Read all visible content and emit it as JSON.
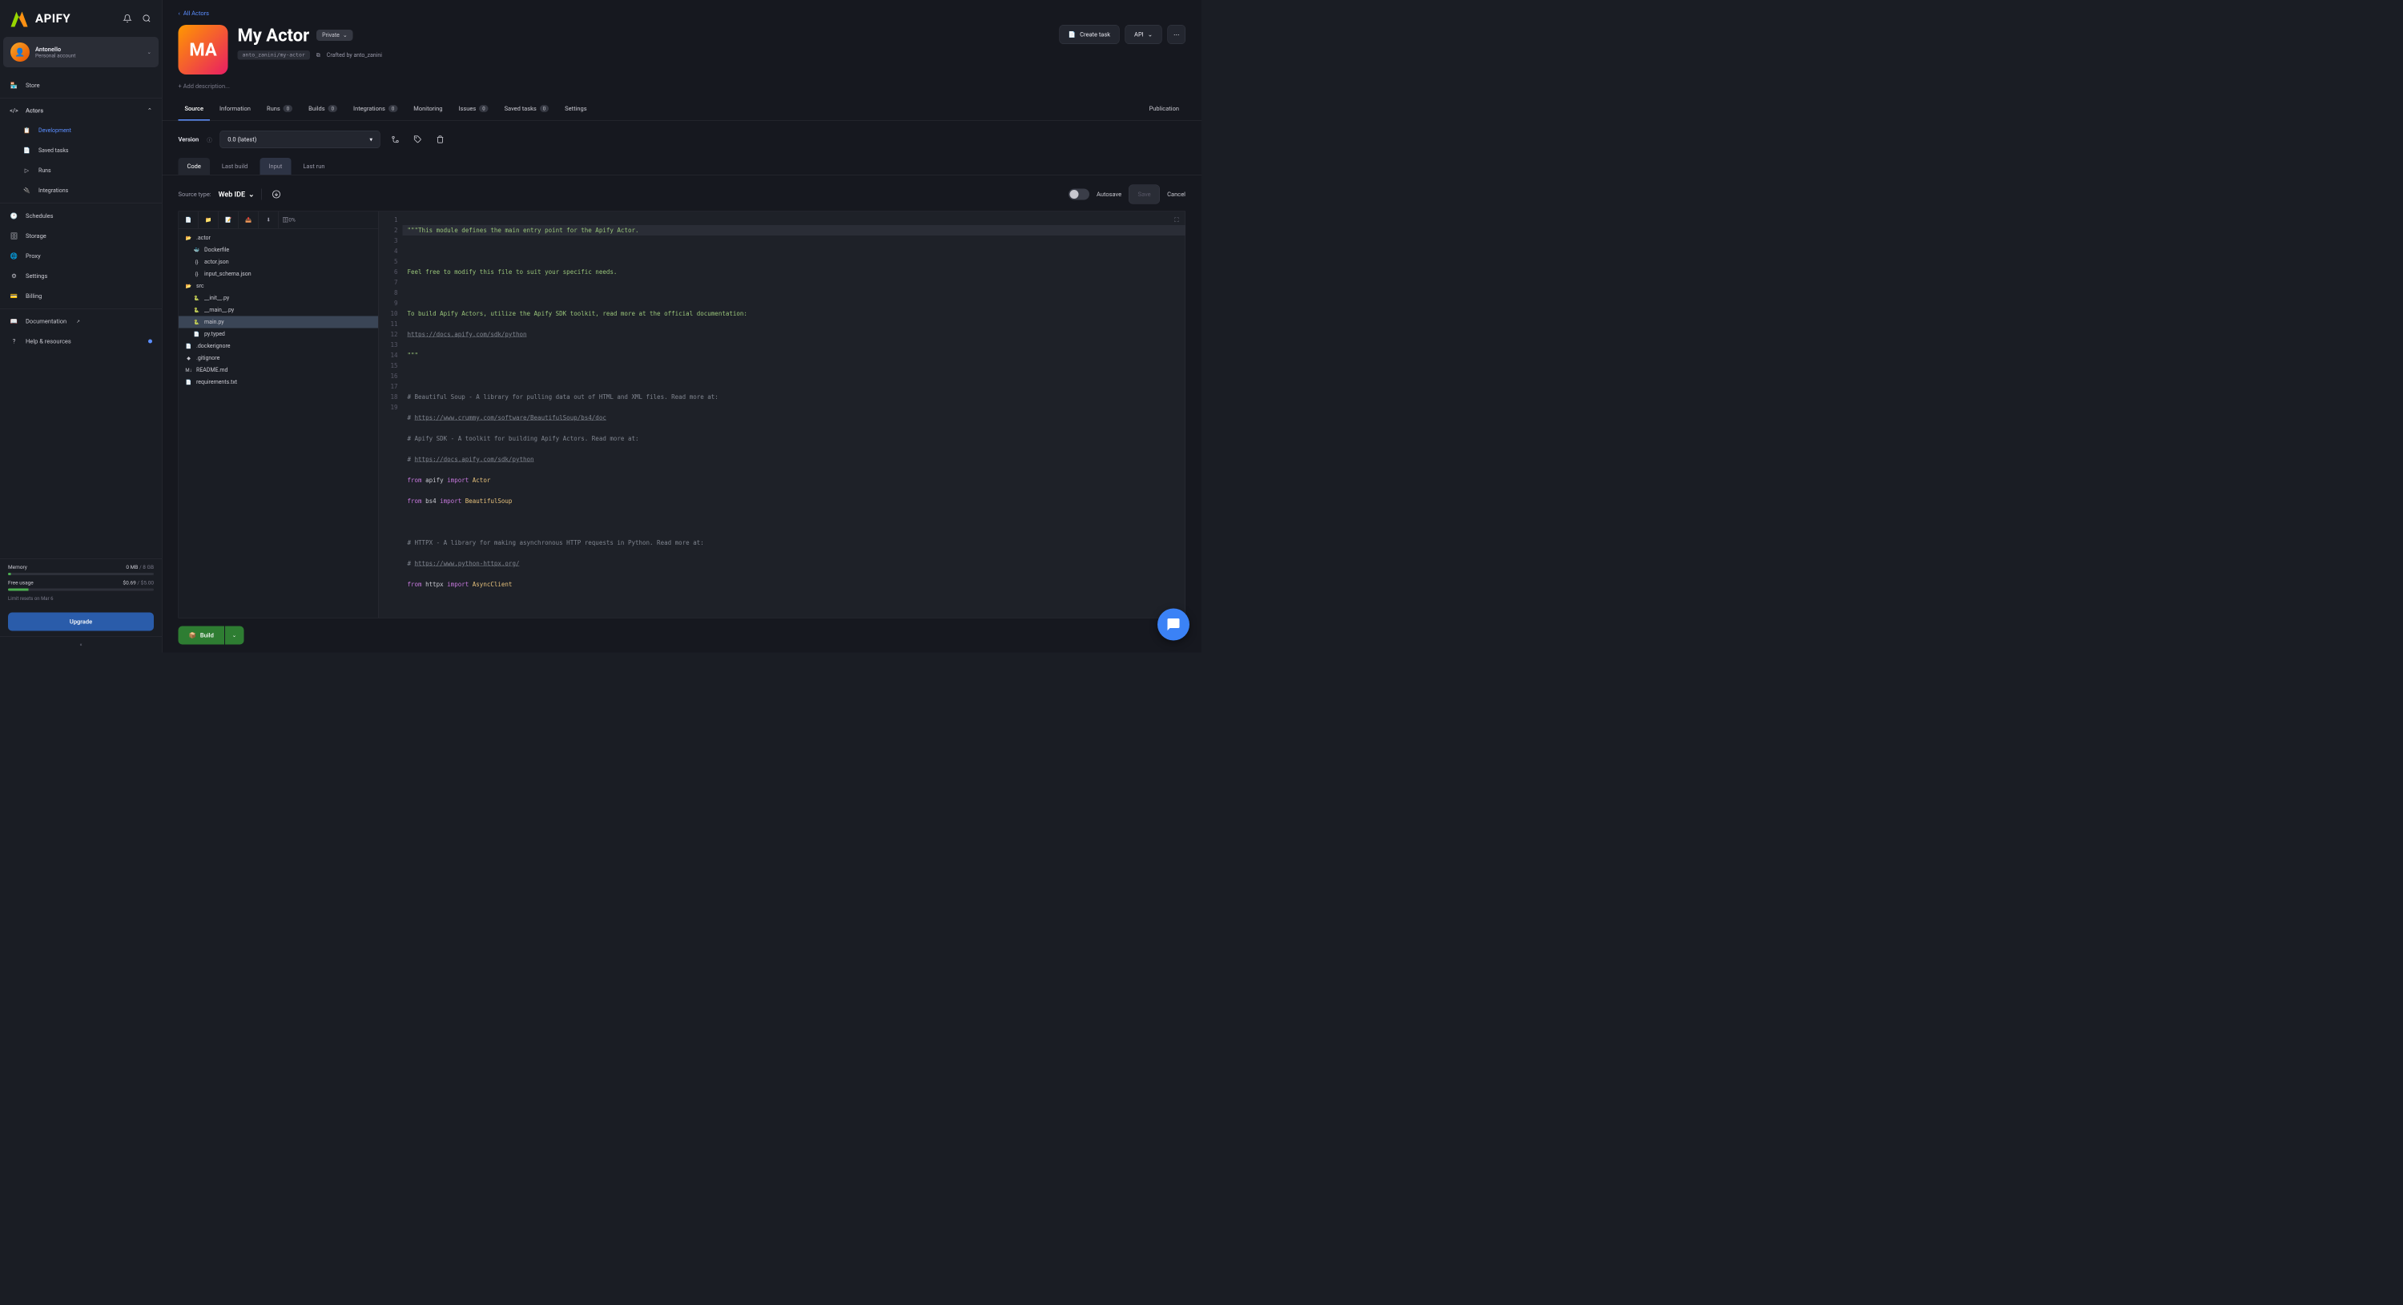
{
  "brand": "APIFY",
  "account": {
    "name": "Antonello",
    "sub": "Personal account"
  },
  "sidebar": {
    "store": "Store",
    "actors": "Actors",
    "dev": "Development",
    "saved": "Saved tasks",
    "runs": "Runs",
    "integrations": "Integrations",
    "schedules": "Schedules",
    "storage": "Storage",
    "proxy": "Proxy",
    "settings": "Settings",
    "billing": "Billing",
    "docs": "Documentation",
    "help": "Help & resources"
  },
  "usage": {
    "memLabel": "Memory",
    "memUsed": "0 MB",
    "memTotal": "/ 8 GB",
    "freeLabel": "Free usage",
    "freeUsed": "$0.69",
    "freeTotal": "/ $5.00",
    "reset": "Limit resets on Mar 6",
    "upgrade": "Upgrade"
  },
  "breadcrumb": {
    "back": "All Actors"
  },
  "actor": {
    "iconText": "MA",
    "title": "My Actor",
    "privacy": "Private",
    "slug": "anto_zanini/my-actor",
    "crafted": "Crafted by",
    "author": "anto_zanini",
    "createTask": "Create task",
    "api": "API",
    "description": "+ Add description..."
  },
  "tabs": {
    "source": "Source",
    "info": "Information",
    "runs": "Runs",
    "runsCount": "0",
    "builds": "Builds",
    "buildsCount": "0",
    "integrations": "Integrations",
    "integrationsCount": "0",
    "monitoring": "Monitoring",
    "issues": "Issues",
    "issuesCount": "0",
    "saved": "Saved tasks",
    "savedCount": "0",
    "settings": "Settings",
    "publication": "Publication"
  },
  "version": {
    "label": "Version",
    "value": "0.0 (latest)"
  },
  "subtabs": {
    "code": "Code",
    "lastBuild": "Last build",
    "input": "Input",
    "lastRun": "Last run"
  },
  "source": {
    "label": "Source type:",
    "type": "Web IDE",
    "autosave": "Autosave",
    "save": "Save",
    "cancel": "Cancel"
  },
  "fileToolbar": {
    "disk": "0%"
  },
  "files": {
    "actor": ".actor",
    "dockerfile": "Dockerfile",
    "actorJson": "actor.json",
    "inputSchema": "input_schema.json",
    "src": "src",
    "init": "__init__.py",
    "main2": "__main__.py",
    "main": "main.py",
    "typed": "py.typed",
    "dockerignore": ".dockerignore",
    "gitignore": ".gitignore",
    "readme": "README.md",
    "req": "requirements.txt"
  },
  "code": {
    "l1": "\"\"\"This module defines the main entry point for the Apify Actor.",
    "l3": "Feel free to modify this file to suit your specific needs.",
    "l5": "To build Apify Actors, utilize the Apify SDK toolkit, read more at the official documentation:",
    "l6": "https://docs.apify.com/sdk/python",
    "l7": "\"\"\"",
    "l9": "# Beautiful Soup - A library for pulling data out of HTML and XML files. Read more at:",
    "l10a": "# ",
    "l10b": "https://www.crummy.com/software/BeautifulSoup/bs4/doc",
    "l11": "# Apify SDK - A toolkit for building Apify Actors. Read more at:",
    "l12a": "# ",
    "l12b": "https://docs.apify.com/sdk/python",
    "l13from": "from",
    "l13mod": " apify ",
    "l13imp": "import",
    "l13cls": " Actor",
    "l14from": "from",
    "l14mod": " bs4 ",
    "l14imp": "import",
    "l14cls": " BeautifulSoup",
    "l16": "# HTTPX - A library for making asynchronous HTTP requests in Python. Read more at:",
    "l17a": "# ",
    "l17b": "https://www.python-httpx.org/",
    "l18from": "from",
    "l18mod": " httpx ",
    "l18imp": "import",
    "l18cls": " AsyncClient"
  },
  "build": "Build"
}
